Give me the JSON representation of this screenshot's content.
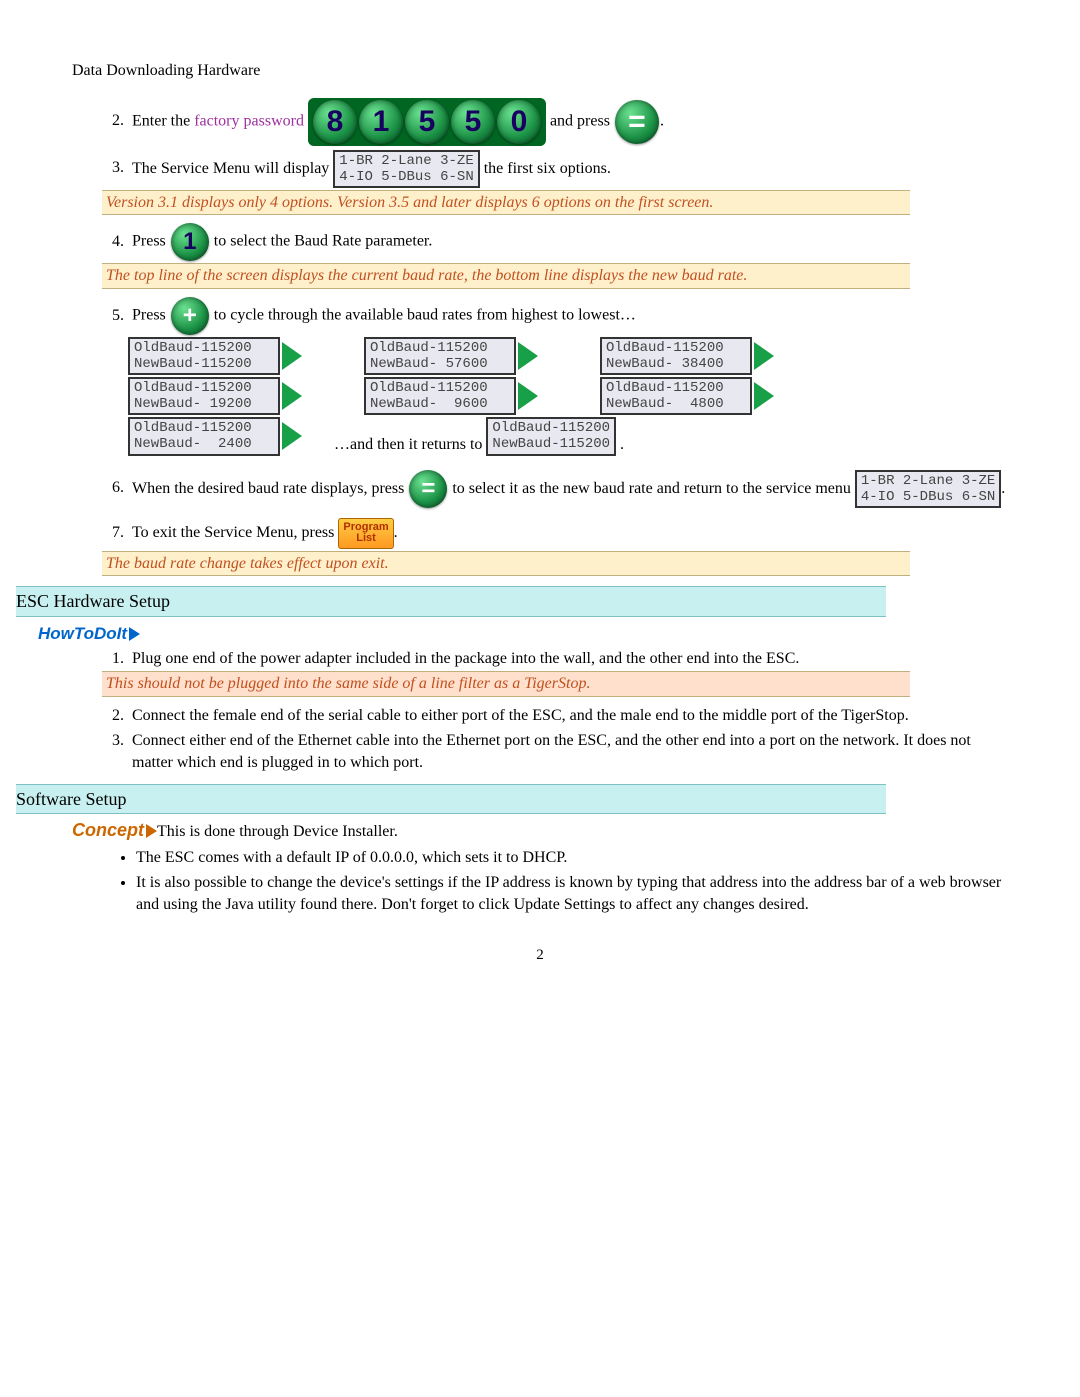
{
  "header": "Data Downloading Hardware",
  "page_number": "2",
  "password_digits": [
    "8",
    "1",
    "5",
    "5",
    "0"
  ],
  "service_menu_lcd": "1-BR 2-Lane 3-ZE\n4-IO 5-DBus 6-SN",
  "step2": {
    "a": "Enter the ",
    "fp": "factory password",
    "b": " and press ",
    "c": "."
  },
  "step3": {
    "a": "The Service Menu will display ",
    "b": " the first six options."
  },
  "note3": "Version 3.1 displays only 4 options.  Version 3.5 and later displays 6 options on the first screen.",
  "step4": {
    "a": "Press ",
    "b": " to select the Baud Rate parameter."
  },
  "note4": "The top line of the screen displays the current baud rate, the bottom line displays the new baud rate.",
  "step5": {
    "a": "Press ",
    "b": " to cycle through the available baud rates from highest to lowest…"
  },
  "baud": {
    "row1": [
      "OldBaud-115200\nNewBaud-115200",
      "OldBaud-115200\nNewBaud- 57600",
      "OldBaud-115200\nNewBaud- 38400"
    ],
    "row2": [
      "OldBaud-115200\nNewBaud- 19200",
      "OldBaud-115200\nNewBaud-  9600",
      "OldBaud-115200\nNewBaud-  4800"
    ],
    "row3_first": "OldBaud-115200\nNewBaud-  2400",
    "returns_text": "…and then it returns to ",
    "returns_lcd": "OldBaud-115200\nNewBaud-115200",
    "returns_dot": "."
  },
  "step6": {
    "a": "When the desired baud rate displays, press ",
    "b": " to select it as the new baud rate and return to the service menu ",
    "c": "."
  },
  "step7": {
    "a": "To exit the Service Menu, press ",
    "b": "."
  },
  "prog_list": {
    "l1": "Program",
    "l2": "List"
  },
  "note7": "The baud rate change takes effect upon exit.",
  "section_esc": "ESC Hardware Setup",
  "howtodoit": "HowToDoIt",
  "esc1": "Plug one end of the power adapter included in the package into the wall, and the other end into the ESC.",
  "esc_note": "This should not be plugged into the same side of a line filter as a TigerStop.",
  "esc2": "Connect the female end of the serial cable to either port of the ESC, and the male end to the middle port of the TigerStop.",
  "esc3": "Connect either end of the Ethernet cable into the Ethernet port on the ESC, and the other end into a port on the network.  It does not matter which end is plugged in to which port.",
  "section_sw": "Software Setup",
  "concept_label": "Concept",
  "concept_text": "This is done through Device Installer.",
  "sw_b1": "The ESC comes with a default IP of 0.0.0.0, which sets it to DHCP.",
  "sw_b2": "It is also possible to change the device's settings if the IP address is known by typing that address into the address bar of a web browser and using the Java utility found there.  Don't forget to click Update Settings to affect any changes desired."
}
